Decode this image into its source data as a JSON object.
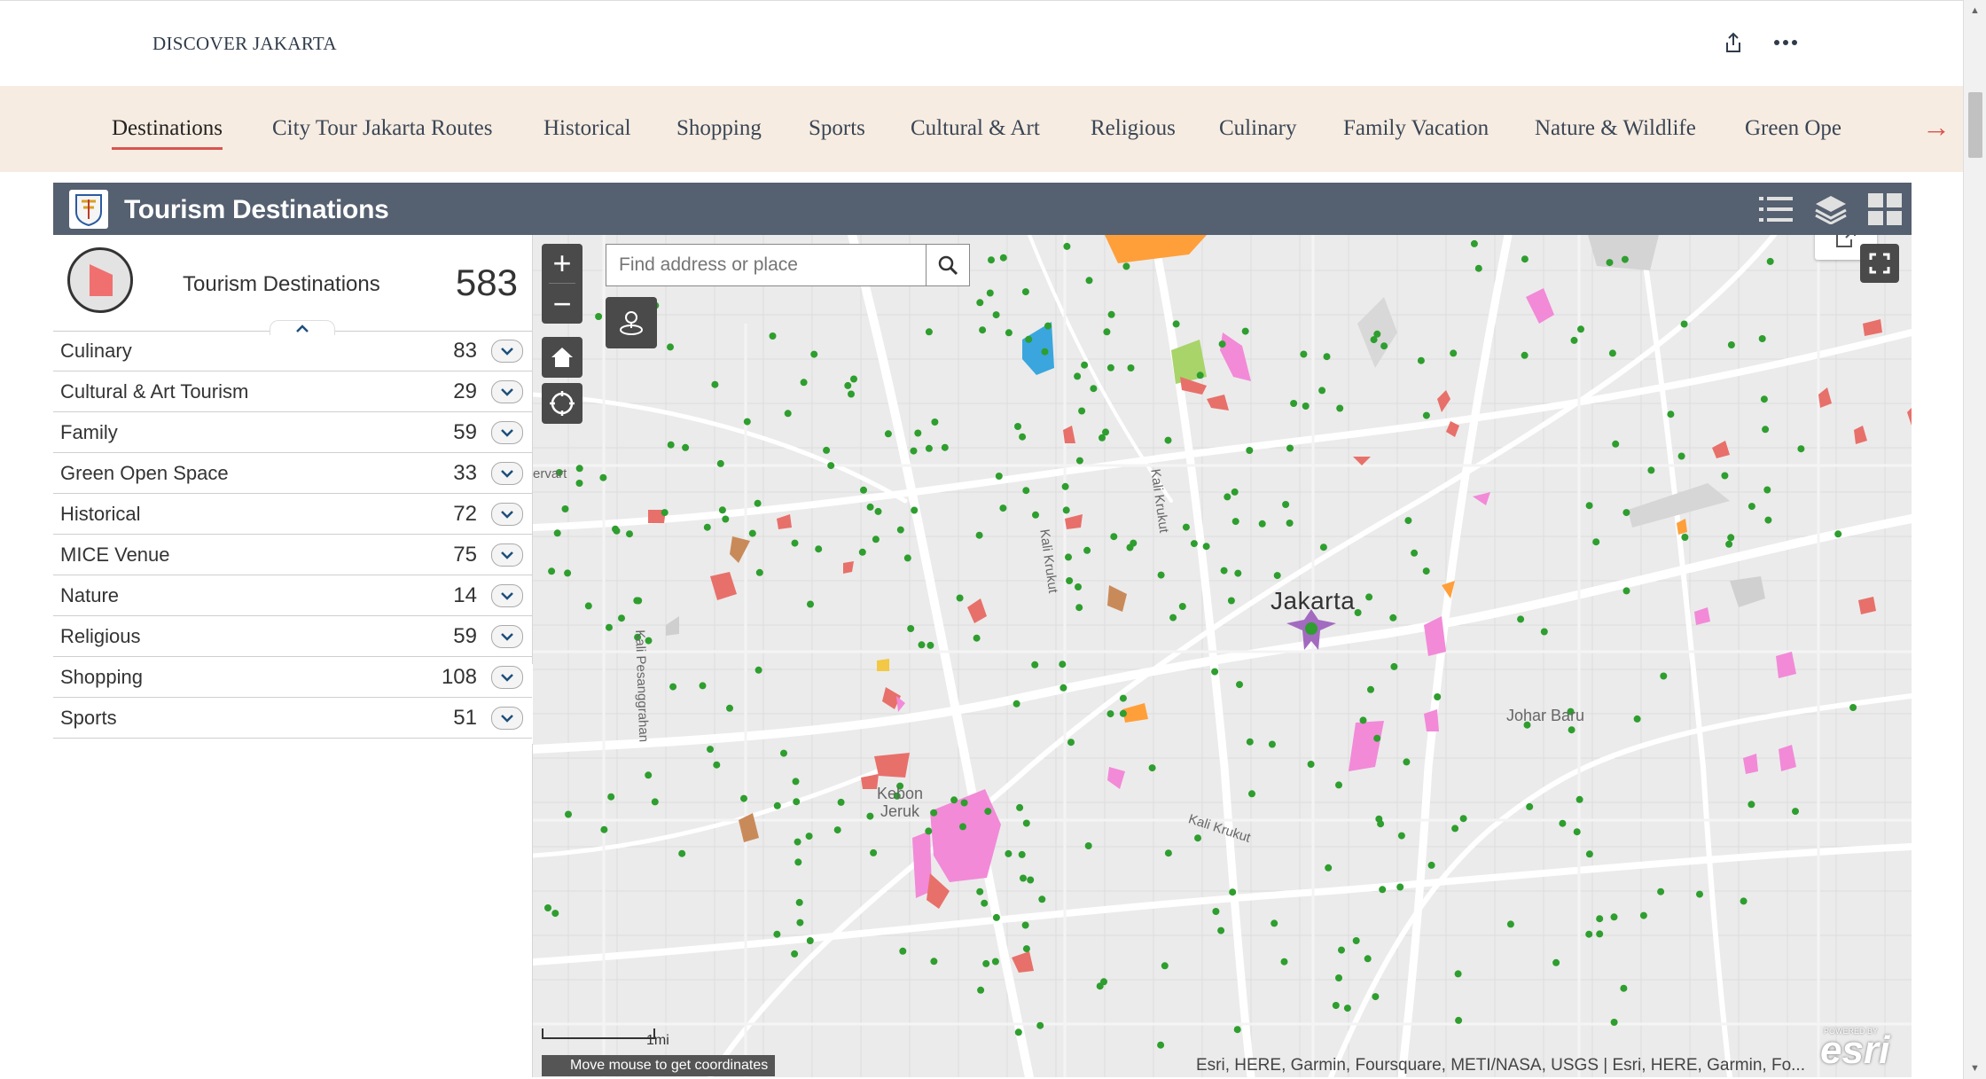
{
  "header": {
    "brand": "DISCOVER JAKARTA",
    "share_icon": "share-icon",
    "more_icon": "more-icon"
  },
  "nav": {
    "items": [
      {
        "label": "Destinations",
        "active": true
      },
      {
        "label": "City Tour Jakarta Routes"
      },
      {
        "label": "Historical"
      },
      {
        "label": "Shopping"
      },
      {
        "label": "Sports"
      },
      {
        "label": "Cultural & Art"
      },
      {
        "label": "Religious"
      },
      {
        "label": "Culinary"
      },
      {
        "label": "Family Vacation"
      },
      {
        "label": "Nature & Wildlife"
      },
      {
        "label": "Green Ope"
      }
    ],
    "next_arrow": "→"
  },
  "widget": {
    "title": "Tourism Destinations",
    "icons": [
      "list-icon",
      "layers-icon",
      "grid-icon"
    ]
  },
  "panel": {
    "summary_label": "Tourism Destinations",
    "summary_count": "583",
    "categories": [
      {
        "label": "Culinary",
        "count": "83"
      },
      {
        "label": "Cultural & Art Tourism",
        "count": "29"
      },
      {
        "label": "Family",
        "count": "59"
      },
      {
        "label": "Green Open Space",
        "count": "33"
      },
      {
        "label": "Historical",
        "count": "72"
      },
      {
        "label": "MICE Venue",
        "count": "75"
      },
      {
        "label": "Nature",
        "count": "14"
      },
      {
        "label": "Religious",
        "count": "59"
      },
      {
        "label": "Shopping",
        "count": "108"
      },
      {
        "label": "Sports",
        "count": "51"
      }
    ]
  },
  "map": {
    "search_placeholder": "Find address or place",
    "city_label": "Jakarta",
    "labels": {
      "johar_baru": "Johar Baru",
      "kebon_jeruk": "Kebon\nJeruk",
      "kali_krukut": "Kali Krukut",
      "kali_krukut_2": "Kali Krukut",
      "kali_krukut_3": "Kali Krukut",
      "kali_pesanggrahan": "Kali Pesanggrahan",
      "ervart": "ervart"
    },
    "scale_label": "1mi",
    "coords_text": "Move mouse to get coordinates",
    "attribution": "Esri, HERE, Garmin, Foursquare, METI/NASA, USGS | Esri, HERE, Garmin, Fo...",
    "esri_logo": "esri",
    "esri_powered": "POWERED BY",
    "colors": {
      "point": "#2e9e2e",
      "culinary_poly": "#e8706a",
      "shopping_poly": "#f28ad8",
      "green_poly": "#a8d46a",
      "family_poly": "#ff9f3a",
      "nature_poly": "#c98a5a",
      "religious_poly": "#3aa6dd",
      "mice_poly": "#a26bbf"
    }
  },
  "accent": "#d9534f"
}
